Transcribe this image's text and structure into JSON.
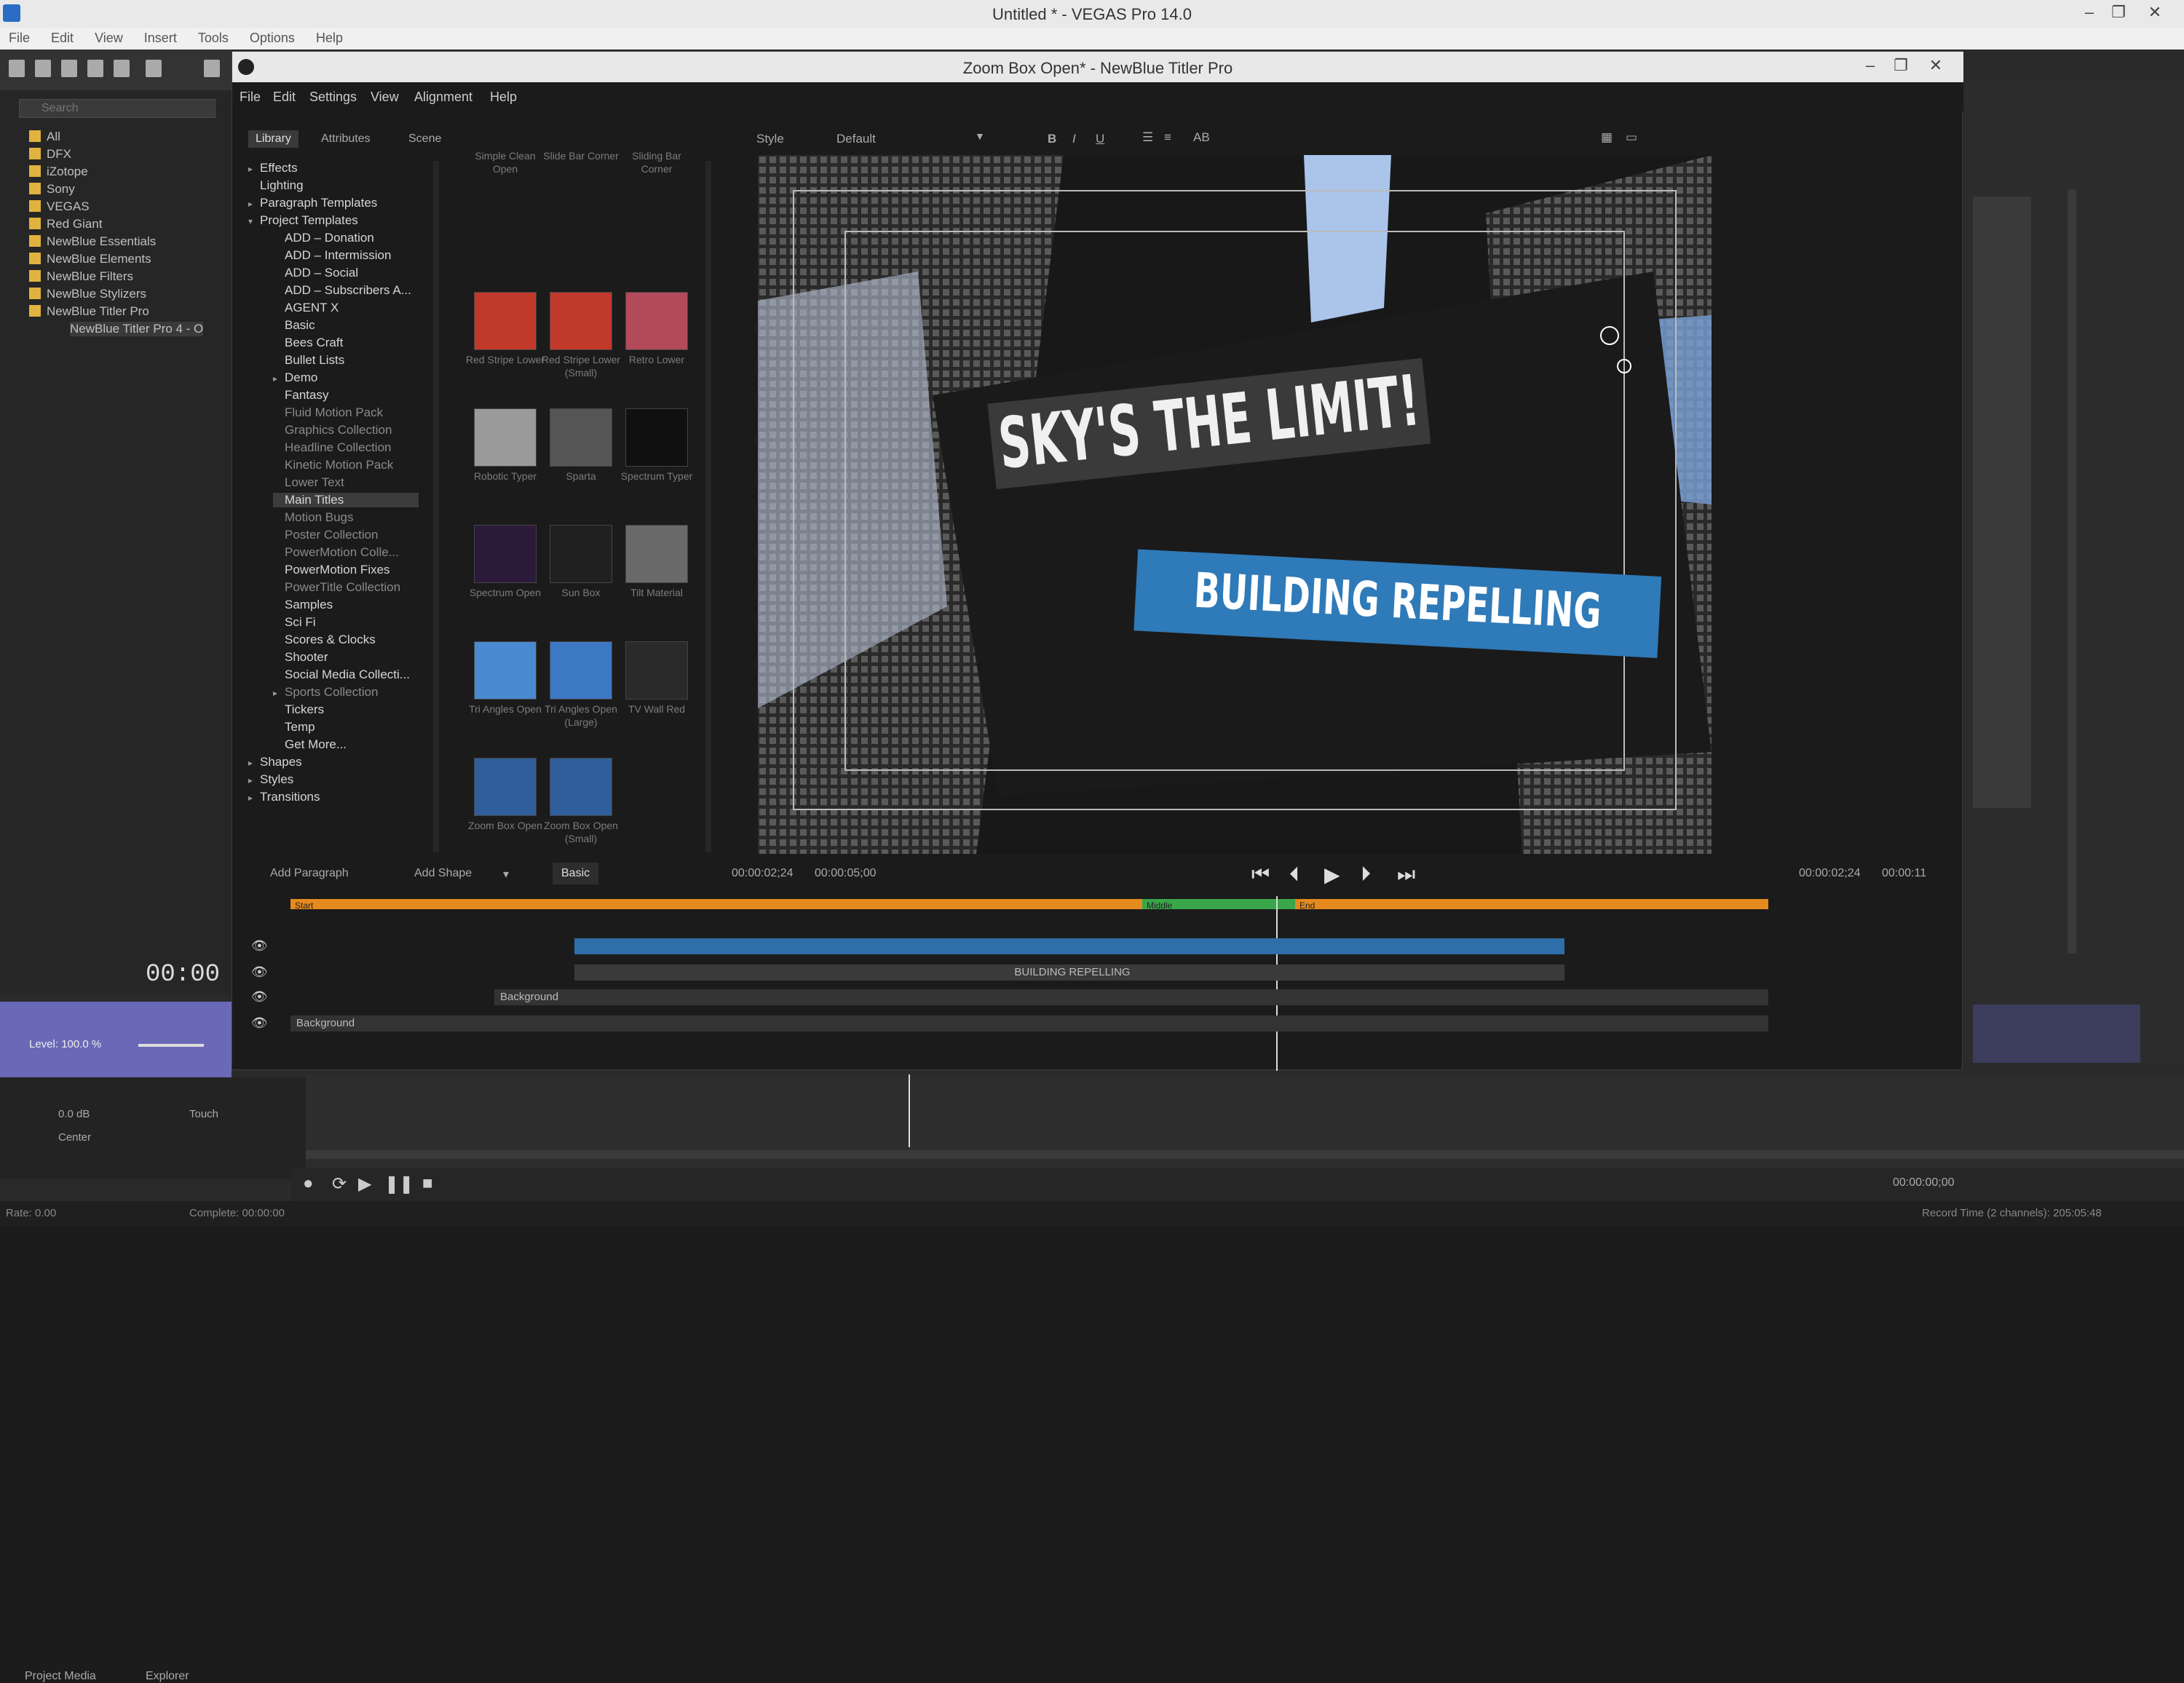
{
  "vegas": {
    "title": "Untitled * - VEGAS Pro 14.0",
    "menu": [
      "File",
      "Edit",
      "View",
      "Insert",
      "Tools",
      "Options",
      "Help"
    ],
    "search_placeholder": "Search",
    "tree": [
      "All",
      "DFX",
      "iZotope",
      "Sony",
      "VEGAS",
      "Red Giant",
      "NewBlue Essentials",
      "NewBlue Elements",
      "NewBlue Filters",
      "NewBlue Stylizers",
      "NewBlue Titler Pro",
      "NewBlue Titler Pro 4 - O"
    ],
    "explorer_tabs": [
      "Project Media",
      "Explorer"
    ],
    "timecode": "00:00",
    "track": {
      "level": "Level: 100.0 %",
      "vol": "0.0 dB",
      "pan": "Center",
      "touch": "Touch"
    },
    "status": [
      "Rate: 0.00",
      "Complete: 00:00:00",
      "Record Time (2 channels): 205:05:48",
      "00:00:00;00"
    ]
  },
  "titler": {
    "title": "Zoom Box Open* - NewBlue Titler Pro",
    "menu": [
      "File",
      "Edit",
      "Settings",
      "View",
      "Alignment",
      "Help"
    ],
    "tabs": [
      "Library",
      "Attributes",
      "Scene"
    ],
    "library": [
      {
        "label": "Effects",
        "arrow": "▸",
        "level": 0,
        "dim": false
      },
      {
        "label": "Lighting",
        "arrow": "",
        "level": 0,
        "dim": false
      },
      {
        "label": "Paragraph Templates",
        "arrow": "▸",
        "level": 0,
        "dim": false
      },
      {
        "label": "Project Templates",
        "arrow": "▾",
        "level": 0,
        "dim": false
      },
      {
        "label": "ADD – Donation",
        "arrow": "",
        "level": 1,
        "dim": false
      },
      {
        "label": "ADD – Intermission",
        "arrow": "",
        "level": 1,
        "dim": false
      },
      {
        "label": "ADD – Social",
        "arrow": "",
        "level": 1,
        "dim": false
      },
      {
        "label": "ADD – Subscribers A...",
        "arrow": "",
        "level": 1,
        "dim": false
      },
      {
        "label": "AGENT X",
        "arrow": "",
        "level": 1,
        "dim": false
      },
      {
        "label": "Basic",
        "arrow": "",
        "level": 1,
        "dim": false
      },
      {
        "label": "Bees Craft",
        "arrow": "",
        "level": 1,
        "dim": false
      },
      {
        "label": "Bullet Lists",
        "arrow": "",
        "level": 1,
        "dim": false
      },
      {
        "label": "Demo",
        "arrow": "▸",
        "level": 1,
        "dim": false
      },
      {
        "label": "Fantasy",
        "arrow": "",
        "level": 1,
        "dim": false
      },
      {
        "label": "Fluid Motion Pack",
        "arrow": "",
        "level": 1,
        "dim": true
      },
      {
        "label": "Graphics Collection",
        "arrow": "",
        "level": 1,
        "dim": true
      },
      {
        "label": "Headline Collection",
        "arrow": "",
        "level": 1,
        "dim": true
      },
      {
        "label": "Kinetic Motion Pack",
        "arrow": "",
        "level": 1,
        "dim": true
      },
      {
        "label": "Lower Text",
        "arrow": "",
        "level": 1,
        "dim": true
      },
      {
        "label": "Main Titles",
        "arrow": "",
        "level": 1,
        "dim": false,
        "sel": true
      },
      {
        "label": "Motion Bugs",
        "arrow": "",
        "level": 1,
        "dim": true
      },
      {
        "label": "Poster Collection",
        "arrow": "",
        "level": 1,
        "dim": true
      },
      {
        "label": "PowerMotion Colle...",
        "arrow": "",
        "level": 1,
        "dim": true
      },
      {
        "label": "PowerMotion Fixes",
        "arrow": "",
        "level": 1,
        "dim": false
      },
      {
        "label": "PowerTitle Collection",
        "arrow": "",
        "level": 1,
        "dim": true
      },
      {
        "label": "Samples",
        "arrow": "",
        "level": 1,
        "dim": false
      },
      {
        "label": "Sci Fi",
        "arrow": "",
        "level": 1,
        "dim": false
      },
      {
        "label": "Scores & Clocks",
        "arrow": "",
        "level": 1,
        "dim": false
      },
      {
        "label": "Shooter",
        "arrow": "",
        "level": 1,
        "dim": false
      },
      {
        "label": "Social Media Collecti...",
        "arrow": "",
        "level": 1,
        "dim": false
      },
      {
        "label": "Sports Collection",
        "arrow": "▸",
        "level": 1,
        "dim": true
      },
      {
        "label": "Tickers",
        "arrow": "",
        "level": 1,
        "dim": false
      },
      {
        "label": "Temp",
        "arrow": "",
        "level": 1,
        "dim": false
      },
      {
        "label": "Get More...",
        "arrow": "",
        "level": 1,
        "dim": false
      },
      {
        "label": "Shapes",
        "arrow": "▸",
        "level": 0,
        "dim": false
      },
      {
        "label": "Styles",
        "arrow": "▸",
        "level": 0,
        "dim": false
      },
      {
        "label": "Transitions",
        "arrow": "▸",
        "level": 0,
        "dim": false
      }
    ],
    "thumbs": [
      {
        "label": "Simple Clean Open",
        "color": "#2a2a2a"
      },
      {
        "label": "Slide Bar Corner",
        "color": "#2a2a2a"
      },
      {
        "label": "Sliding Bar Corner",
        "color": "#2a2a2a"
      },
      {
        "label": "Red Stripe Lower",
        "color": "#c0392b"
      },
      {
        "label": "Red Stripe Lower (Small)",
        "color": "#c0392b"
      },
      {
        "label": "Retro Lower",
        "color": "#b24a5a"
      },
      {
        "label": "Robotic Typer",
        "color": "#9a9a9a"
      },
      {
        "label": "Sparta",
        "color": "#555555"
      },
      {
        "label": "Spectrum Typer",
        "color": "#101010"
      },
      {
        "label": "Spectrum Open",
        "color": "#2c1a3a"
      },
      {
        "label": "Sun Box",
        "color": "#202020"
      },
      {
        "label": "Tilt Material",
        "color": "#6a6a6a"
      },
      {
        "label": "Tri Angles Open",
        "color": "#4a8ad0"
      },
      {
        "label": "Tri Angles Open (Large)",
        "color": "#3d78c4"
      },
      {
        "label": "TV Wall Red",
        "color": "#2a2a2a"
      },
      {
        "label": "Zoom Box Open",
        "color": "#2f5e9a"
      },
      {
        "label": "Zoom Box Open (Small)",
        "color": "#2f5e9a"
      }
    ],
    "style_toolbar": {
      "style_label": "Style",
      "style_value": "Default",
      "bold": "B",
      "italic": "I",
      "underline": "U"
    },
    "preview": {
      "headline": "SKY'S THE LIMIT!",
      "subline": "BUILDING REPELLING"
    },
    "timeline": {
      "add_paragraph": "Add Paragraph",
      "add_shape": "Add Shape",
      "mode": "Basic",
      "time_a": "00:00:02;24",
      "time_b": "00:00:05;00",
      "time_c": "00:00:02;24",
      "time_d": "00:00:11",
      "bar_labels": [
        "Start",
        "Middle",
        "End"
      ],
      "tracks": [
        "BUILDING REPELLING",
        "Background",
        "Background"
      ]
    }
  }
}
